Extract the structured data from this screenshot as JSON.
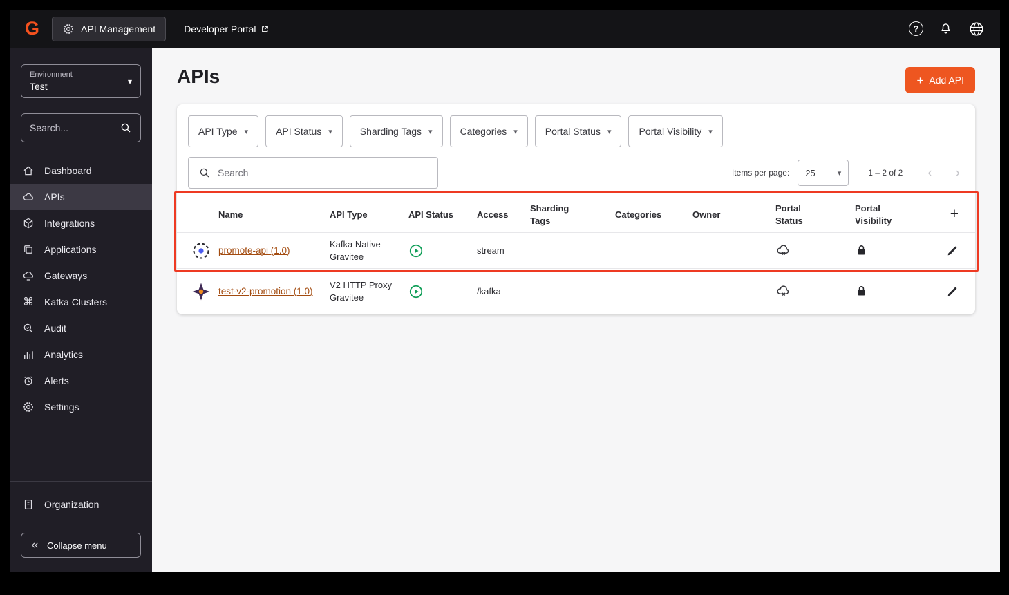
{
  "topbar": {
    "app_button_label": "API Management",
    "portal_link_label": "Developer Portal"
  },
  "sidebar": {
    "environment_label": "Environment",
    "environment_value": "Test",
    "search_placeholder": "Search...",
    "items": [
      {
        "label": "Dashboard",
        "icon": "home-icon"
      },
      {
        "label": "APIs",
        "icon": "cloud-icon",
        "active": true
      },
      {
        "label": "Integrations",
        "icon": "package-icon"
      },
      {
        "label": "Applications",
        "icon": "copy-icon"
      },
      {
        "label": "Gateways",
        "icon": "cloud-gateway-icon"
      },
      {
        "label": "Kafka Clusters",
        "icon": "command-icon"
      },
      {
        "label": "Audit",
        "icon": "magnifier-check-icon"
      },
      {
        "label": "Analytics",
        "icon": "bar-chart-icon"
      },
      {
        "label": "Alerts",
        "icon": "alarm-clock-icon"
      },
      {
        "label": "Settings",
        "icon": "gear-icon"
      }
    ],
    "organization_label": "Organization",
    "collapse_label": "Collapse menu"
  },
  "main": {
    "page_title": "APIs",
    "add_api_label": "Add API",
    "filters": [
      {
        "label": "API Type"
      },
      {
        "label": "API Status"
      },
      {
        "label": "Sharding Tags"
      },
      {
        "label": "Categories"
      },
      {
        "label": "Portal Status"
      },
      {
        "label": "Portal Visibility"
      }
    ],
    "search_placeholder": "Search",
    "pagination": {
      "items_per_page_label": "Items per page:",
      "items_per_page_value": "25",
      "range_label": "1 – 2 of 2"
    },
    "table": {
      "columns": [
        "Name",
        "API Type",
        "API Status",
        "Access",
        "Sharding Tags",
        "Categories",
        "Owner",
        "Portal Status",
        "Portal Visibility"
      ],
      "rows": [
        {
          "name": "promote-api (1.0)",
          "api_type": "Kafka Native Gravitee",
          "api_status": "started",
          "access": "stream",
          "sharding_tags": "",
          "categories": "",
          "owner": "",
          "portal_status": "unpublished",
          "portal_visibility": "private"
        },
        {
          "name": "test-v2-promotion (1.0)",
          "api_type": "V2 HTTP Proxy Gravitee",
          "api_status": "started",
          "access": "/kafka",
          "sharding_tags": "",
          "categories": "",
          "owner": "",
          "portal_status": "unpublished",
          "portal_visibility": "private"
        }
      ]
    }
  },
  "icons": {
    "caret_down": "▾",
    "plus": "+",
    "chevron_left": "‹",
    "chevron_right": "›",
    "help": "?",
    "command": "⌘"
  },
  "colors": {
    "accent_orange": "#ee5620",
    "annotation_red": "#ee3a23",
    "status_green": "#0f9e57",
    "link_color": "#a34b0f"
  },
  "annotation": {
    "type": "highlight-rectangle",
    "target": "table-header-and-first-row"
  }
}
